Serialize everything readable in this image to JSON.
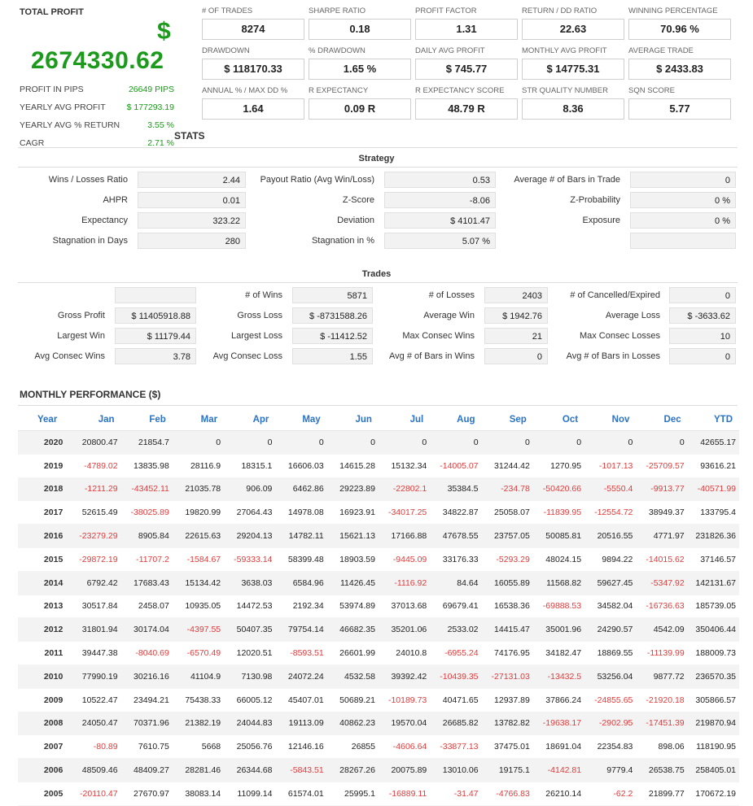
{
  "summary": {
    "title": "TOTAL PROFIT",
    "currency_symbol": "$",
    "total_profit": "2674330.62",
    "rows": [
      {
        "label": "PROFIT IN PIPS",
        "value": "26649 PIPS"
      },
      {
        "label": "YEARLY AVG PROFIT",
        "value": "$ 177293.19"
      },
      {
        "label": "YEARLY AVG % RETURN",
        "value": "3.55 %"
      },
      {
        "label": "CAGR",
        "value": "2.71 %"
      }
    ]
  },
  "kpis": [
    {
      "label": "# OF TRADES",
      "value": "8274"
    },
    {
      "label": "SHARPE RATIO",
      "value": "0.18"
    },
    {
      "label": "PROFIT FACTOR",
      "value": "1.31"
    },
    {
      "label": "RETURN / DD RATIO",
      "value": "22.63"
    },
    {
      "label": "WINNING PERCENTAGE",
      "value": "70.96 %"
    },
    {
      "label": "DRAWDOWN",
      "value": "$ 118170.33"
    },
    {
      "label": "% DRAWDOWN",
      "value": "1.65 %"
    },
    {
      "label": "DAILY AVG PROFIT",
      "value": "$ 745.77"
    },
    {
      "label": "MONTHLY AVG PROFIT",
      "value": "$ 14775.31"
    },
    {
      "label": "AVERAGE TRADE",
      "value": "$ 2433.83"
    },
    {
      "label": "ANNUAL % / MAX DD %",
      "value": "1.64"
    },
    {
      "label": "R EXPECTANCY",
      "value": "0.09 R"
    },
    {
      "label": "R EXPECTANCY SCORE",
      "value": "48.79 R"
    },
    {
      "label": "STR QUALITY NUMBER",
      "value": "8.36"
    },
    {
      "label": "SQN SCORE",
      "value": "5.77"
    }
  ],
  "stats_title": "STATS",
  "strategy": {
    "title": "Strategy",
    "rows": [
      [
        {
          "label": "Wins / Losses Ratio",
          "value": "2.44"
        },
        {
          "label": "Payout Ratio (Avg Win/Loss)",
          "value": "0.53"
        },
        {
          "label": "Average # of Bars in Trade",
          "value": "0"
        }
      ],
      [
        {
          "label": "AHPR",
          "value": "0.01"
        },
        {
          "label": "Z-Score",
          "value": "-8.06"
        },
        {
          "label": "Z-Probability",
          "value": "0 %"
        }
      ],
      [
        {
          "label": "Expectancy",
          "value": "323.22"
        },
        {
          "label": "Deviation",
          "value": "$ 4101.47"
        },
        {
          "label": "Exposure",
          "value": "0 %"
        }
      ],
      [
        {
          "label": "Stagnation in Days",
          "value": "280"
        },
        {
          "label": "Stagnation in %",
          "value": "5.07 %"
        },
        {
          "label": "",
          "value": ""
        }
      ]
    ]
  },
  "trades": {
    "title": "Trades",
    "rows": [
      [
        {
          "label": "",
          "value": ""
        },
        {
          "label": "# of Wins",
          "value": "5871"
        },
        {
          "label": "# of Losses",
          "value": "2403"
        },
        {
          "label": "# of Cancelled/Expired",
          "value": "0"
        }
      ],
      [
        {
          "label": "Gross Profit",
          "value": "$ 11405918.88"
        },
        {
          "label": "Gross Loss",
          "value": "$ -8731588.26"
        },
        {
          "label": "Average Win",
          "value": "$ 1942.76"
        },
        {
          "label": "Average Loss",
          "value": "$ -3633.62"
        }
      ],
      [
        {
          "label": "Largest Win",
          "value": "$ 11179.44"
        },
        {
          "label": "Largest Loss",
          "value": "$ -11412.52"
        },
        {
          "label": "Max Consec Wins",
          "value": "21"
        },
        {
          "label": "Max Consec Losses",
          "value": "10"
        }
      ],
      [
        {
          "label": "Avg Consec Wins",
          "value": "3.78"
        },
        {
          "label": "Avg Consec Loss",
          "value": "1.55"
        },
        {
          "label": "Avg # of Bars in Wins",
          "value": "0"
        },
        {
          "label": "Avg # of Bars in Losses",
          "value": "0"
        }
      ]
    ]
  },
  "monthly": {
    "title": "MONTHLY PERFORMANCE ($)",
    "headers": [
      "Year",
      "Jan",
      "Feb",
      "Mar",
      "Apr",
      "May",
      "Jun",
      "Jul",
      "Aug",
      "Sep",
      "Oct",
      "Nov",
      "Dec",
      "YTD"
    ],
    "rows": [
      [
        "2020",
        "20800.47",
        "21854.7",
        "0",
        "0",
        "0",
        "0",
        "0",
        "0",
        "0",
        "0",
        "0",
        "0",
        "42655.17"
      ],
      [
        "2019",
        "-4789.02",
        "13835.98",
        "28116.9",
        "18315.1",
        "16606.03",
        "14615.28",
        "15132.34",
        "-14005.07",
        "31244.42",
        "1270.95",
        "-1017.13",
        "-25709.57",
        "93616.21"
      ],
      [
        "2018",
        "-1211.29",
        "-43452.11",
        "21035.78",
        "906.09",
        "6462.86",
        "29223.89",
        "-22802.1",
        "35384.5",
        "-234.78",
        "-50420.66",
        "-5550.4",
        "-9913.77",
        "-40571.99"
      ],
      [
        "2017",
        "52615.49",
        "-38025.89",
        "19820.99",
        "27064.43",
        "14978.08",
        "16923.91",
        "-34017.25",
        "34822.87",
        "25058.07",
        "-11839.95",
        "-12554.72",
        "38949.37",
        "133795.4"
      ],
      [
        "2016",
        "-23279.29",
        "8905.84",
        "22615.63",
        "29204.13",
        "14782.11",
        "15621.13",
        "17166.88",
        "47678.55",
        "23757.05",
        "50085.81",
        "20516.55",
        "4771.97",
        "231826.36"
      ],
      [
        "2015",
        "-29872.19",
        "-11707.2",
        "-1584.67",
        "-59333.14",
        "58399.48",
        "18903.59",
        "-9445.09",
        "33176.33",
        "-5293.29",
        "48024.15",
        "9894.22",
        "-14015.62",
        "37146.57"
      ],
      [
        "2014",
        "6792.42",
        "17683.43",
        "15134.42",
        "3638.03",
        "6584.96",
        "11426.45",
        "-1116.92",
        "84.64",
        "16055.89",
        "11568.82",
        "59627.45",
        "-5347.92",
        "142131.67"
      ],
      [
        "2013",
        "30517.84",
        "2458.07",
        "10935.05",
        "14472.53",
        "2192.34",
        "53974.89",
        "37013.68",
        "69679.41",
        "16538.36",
        "-69888.53",
        "34582.04",
        "-16736.63",
        "185739.05"
      ],
      [
        "2012",
        "31801.94",
        "30174.04",
        "-4397.55",
        "50407.35",
        "79754.14",
        "46682.35",
        "35201.06",
        "2533.02",
        "14415.47",
        "35001.96",
        "24290.57",
        "4542.09",
        "350406.44"
      ],
      [
        "2011",
        "39447.38",
        "-8040.69",
        "-6570.49",
        "12020.51",
        "-8593.51",
        "26601.99",
        "24010.8",
        "-6955.24",
        "74176.95",
        "34182.47",
        "18869.55",
        "-11139.99",
        "188009.73"
      ],
      [
        "2010",
        "77990.19",
        "30216.16",
        "41104.9",
        "7130.98",
        "24072.24",
        "4532.58",
        "39392.42",
        "-10439.35",
        "-27131.03",
        "-13432.5",
        "53256.04",
        "9877.72",
        "236570.35"
      ],
      [
        "2009",
        "10522.47",
        "23494.21",
        "75438.33",
        "66005.12",
        "45407.01",
        "50689.21",
        "-10189.73",
        "40471.65",
        "12937.89",
        "37866.24",
        "-24855.65",
        "-21920.18",
        "305866.57"
      ],
      [
        "2008",
        "24050.47",
        "70371.96",
        "21382.19",
        "24044.83",
        "19113.09",
        "40862.23",
        "19570.04",
        "26685.82",
        "13782.82",
        "-19638.17",
        "-2902.95",
        "-17451.39",
        "219870.94"
      ],
      [
        "2007",
        "-80.89",
        "7610.75",
        "5668",
        "25056.76",
        "12146.16",
        "26855",
        "-4606.64",
        "-33877.13",
        "37475.01",
        "18691.04",
        "22354.83",
        "898.06",
        "118190.95"
      ],
      [
        "2006",
        "48509.46",
        "48409.27",
        "28281.46",
        "26344.68",
        "-5843.51",
        "28267.26",
        "20075.89",
        "13010.06",
        "19175.1",
        "-4142.81",
        "9779.4",
        "26538.75",
        "258405.01"
      ],
      [
        "2005",
        "-20110.47",
        "27670.97",
        "38083.14",
        "11099.14",
        "61574.01",
        "25995.1",
        "-16889.11",
        "-31.47",
        "-4766.83",
        "26210.14",
        "-62.2",
        "21899.77",
        "170672.19"
      ]
    ]
  },
  "colors": {
    "positive": "#1b9a1b",
    "negative": "#e23b3b",
    "header_accent": "#2a73c8"
  }
}
